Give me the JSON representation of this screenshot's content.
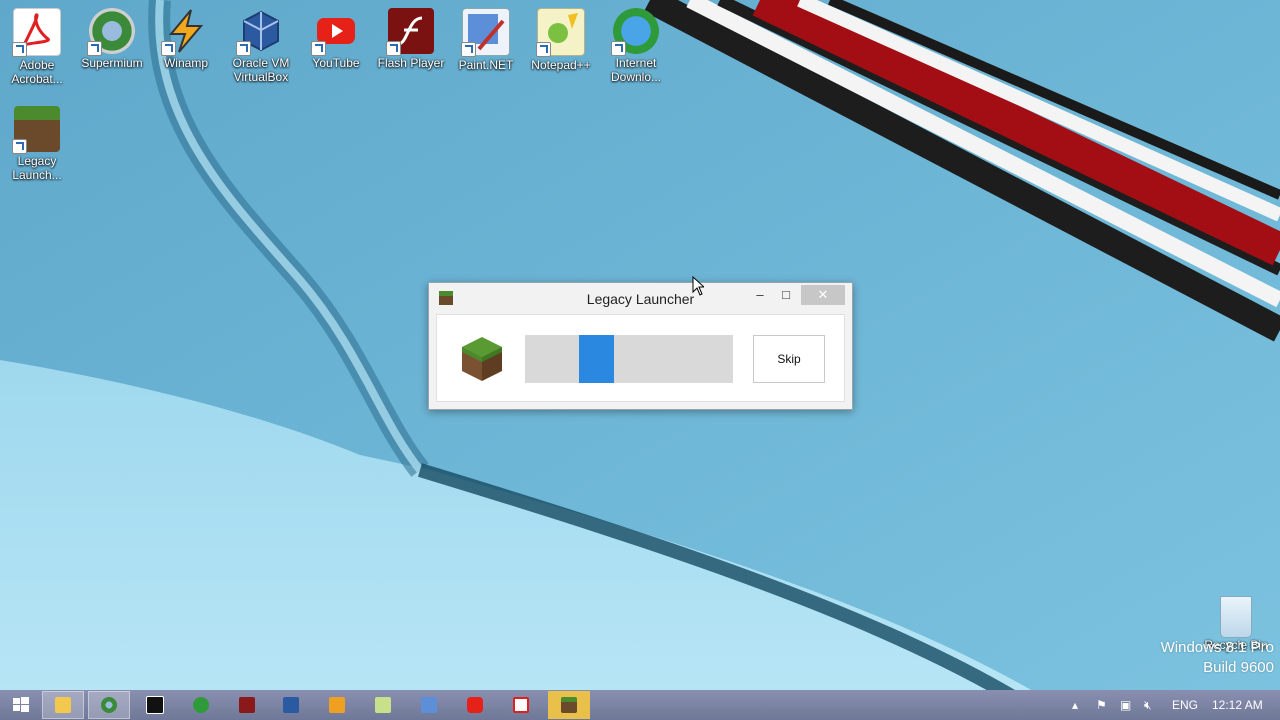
{
  "desktop": {
    "icons": [
      {
        "label": "Adobe Acrobat...",
        "icon": "adobe-acrobat-icon",
        "color": "#e83a2a"
      },
      {
        "label": "Supermium",
        "icon": "supermium-icon",
        "color": "#4a8a3a"
      },
      {
        "label": "Winamp",
        "icon": "winamp-icon",
        "color": "#f0a020"
      },
      {
        "label": "Oracle VM VirtualBox",
        "icon": "virtualbox-icon",
        "color": "#2a5aa0"
      },
      {
        "label": "YouTube",
        "icon": "youtube-icon",
        "color": "#e62117"
      },
      {
        "label": "Flash Player",
        "icon": "flash-player-icon",
        "color": "#8a1a1a"
      },
      {
        "label": "Paint.NET",
        "icon": "paint-net-icon",
        "color": "#3a6fc0"
      },
      {
        "label": "Notepad++",
        "icon": "notepad-plus-plus-icon",
        "color": "#8bc34a"
      },
      {
        "label": "Internet Downlo...",
        "icon": "internet-download-manager-icon",
        "color": "#2f9a3a"
      },
      {
        "label": "Legacy Launch...",
        "icon": "legacy-launcher-icon",
        "color": "#6b4a2b"
      }
    ],
    "recycle_bin": {
      "label": "Recycle Bin",
      "icon": "recycle-bin-icon"
    },
    "watermark": {
      "line1": "Windows 8.1 Pro",
      "line2": "Build 9600"
    }
  },
  "dialog": {
    "title": "Legacy Launcher",
    "minimize": "–",
    "maximize": "□",
    "close": "✕",
    "skip_label": "Skip",
    "progress_start": 0.26,
    "progress_width": 0.17,
    "accent": "#2b88e0"
  },
  "taskbar": {
    "items": [
      {
        "icon": "start-icon"
      },
      {
        "icon": "file-explorer-icon"
      },
      {
        "icon": "supermium-icon"
      },
      {
        "icon": "7zip-icon"
      },
      {
        "icon": "internet-download-manager-icon"
      },
      {
        "icon": "flash-player-icon"
      },
      {
        "icon": "virtualbox-icon"
      },
      {
        "icon": "winamp-icon"
      },
      {
        "icon": "notepad-plus-plus-icon"
      },
      {
        "icon": "paint-net-icon"
      },
      {
        "icon": "youtube-icon"
      },
      {
        "icon": "adobe-acrobat-icon"
      },
      {
        "icon": "legacy-launcher-icon"
      }
    ],
    "tray": {
      "language": "ENG",
      "time": "12:12 AM"
    }
  }
}
